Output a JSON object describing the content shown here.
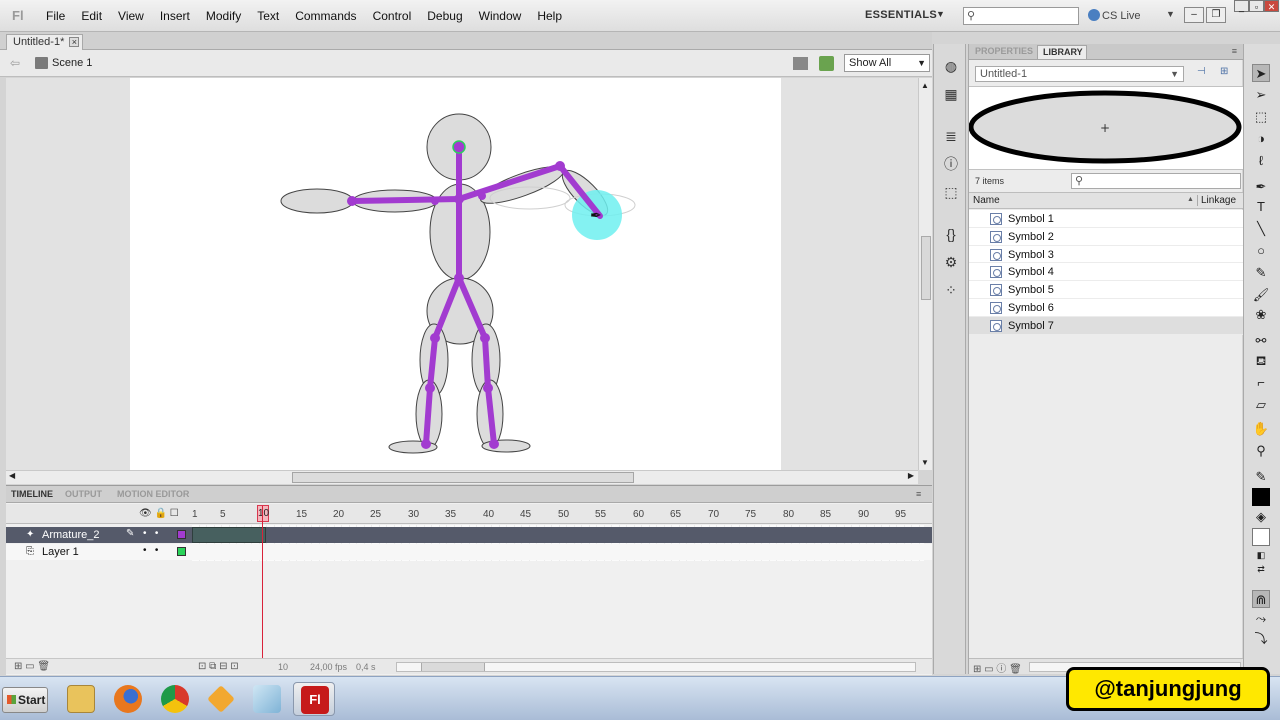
{
  "app": {
    "logo": "Fl",
    "menus": [
      "File",
      "Edit",
      "View",
      "Insert",
      "Modify",
      "Text",
      "Commands",
      "Control",
      "Debug",
      "Window",
      "Help"
    ],
    "workspace": "ESSENTIALS",
    "cs_live": "CS Live"
  },
  "document": {
    "tab_title": "Untitled-1*",
    "scene": "Scene 1",
    "zoom_option": "Show All"
  },
  "timeline": {
    "tabs": [
      "TIMELINE",
      "OUTPUT",
      "MOTION EDITOR"
    ],
    "ruler": [
      "1",
      "5",
      "10",
      "15",
      "20",
      "25",
      "30",
      "35",
      "40",
      "45",
      "50",
      "55",
      "60",
      "65",
      "70",
      "75",
      "80",
      "85",
      "90",
      "95"
    ],
    "current_frame": "10",
    "layers": [
      {
        "name": "Armature_2",
        "color": "#a23bd0"
      },
      {
        "name": "Layer 1",
        "color": "#2ad35a"
      }
    ],
    "status": {
      "frame": "10",
      "fps": "24,00 fps",
      "time": "0,4 s"
    }
  },
  "library": {
    "tabs": [
      "PROPERTIES",
      "LIBRARY"
    ],
    "doc_select": "Untitled-1",
    "item_count": "7 items",
    "col_name": "Name",
    "col_linkage": "Linkage",
    "items": [
      "Symbol 1",
      "Symbol 2",
      "Symbol 3",
      "Symbol 4",
      "Symbol 5",
      "Symbol 6",
      "Symbol 7"
    ],
    "selected_item": "Symbol 7"
  },
  "taskbar": {
    "start_label": "Start",
    "flash_icon_label": "Fl"
  },
  "watermark": "@tanjungjung",
  "colors": {
    "bone": "#a23bd0",
    "joint_highlight": "#6ff0f0",
    "body_fill": "#dcdcdc",
    "playhead": "#d9223a"
  }
}
